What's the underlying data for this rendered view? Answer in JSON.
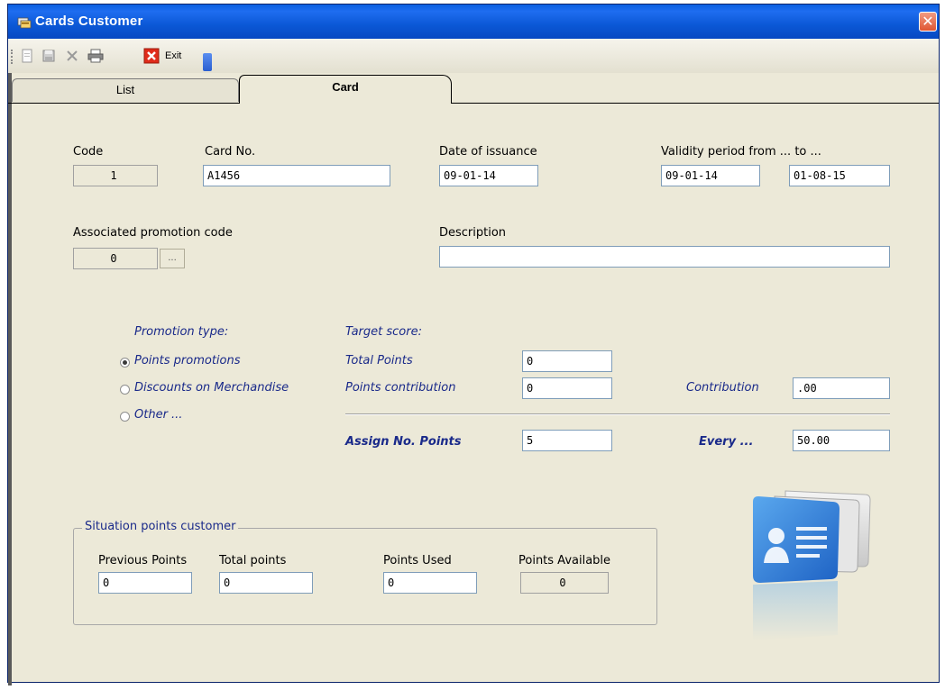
{
  "window": {
    "title": "Cards Customer",
    "close_glyph": "✕"
  },
  "toolbar": {
    "buttons": [
      {
        "icon": "new-document-icon"
      },
      {
        "icon": "save-icon"
      },
      {
        "icon": "delete-icon"
      },
      {
        "icon": "print-icon"
      },
      {
        "icon": "exit-icon"
      }
    ],
    "exit_label": "Exit"
  },
  "tabs": [
    {
      "label": "List",
      "active": false
    },
    {
      "label": "Card",
      "active": true
    }
  ],
  "form": {
    "code": {
      "label": "Code",
      "value": "1"
    },
    "card_no": {
      "label": "Card No.",
      "value": "A1456"
    },
    "issuance": {
      "label": "Date of issuance",
      "value": "09-01-14"
    },
    "validity": {
      "label": "Validity period from ... to ...",
      "from": "09-01-14",
      "to": "01-08-15"
    },
    "promotion_code": {
      "label": "Associated promotion code",
      "value": "0",
      "button": "..."
    },
    "description": {
      "label": "Description",
      "value": ""
    }
  },
  "promotion": {
    "label": "Promotion type:",
    "options": [
      {
        "label": "Points promotions",
        "selected": true
      },
      {
        "label": "Discounts on Merchandise",
        "selected": false
      },
      {
        "label": "Other ...",
        "selected": false
      }
    ]
  },
  "target": {
    "label": "Target score:",
    "total_points": {
      "label": "Total Points",
      "value": "0"
    },
    "points_contribution": {
      "label": "Points contribution",
      "value": "0"
    },
    "contribution": {
      "label": "Contribution",
      "value": ".00"
    },
    "assign_points": {
      "label": "Assign No. Points",
      "value": "5"
    },
    "every": {
      "label": "Every ...",
      "value": "50.00"
    }
  },
  "situation": {
    "title": "Situation points customer",
    "previous_points": {
      "label": "Previous Points",
      "value": "0"
    },
    "total_points": {
      "label": "Total points",
      "value": "0"
    },
    "points_used": {
      "label": "Points Used",
      "value": "0"
    },
    "points_available": {
      "label": "Points Available",
      "value": "0"
    }
  },
  "colors": {
    "titlebar": "#0b58d6",
    "face": "#ece9d8",
    "label_blue": "#1a2a8a",
    "card_icon": "#2f7fd6"
  }
}
